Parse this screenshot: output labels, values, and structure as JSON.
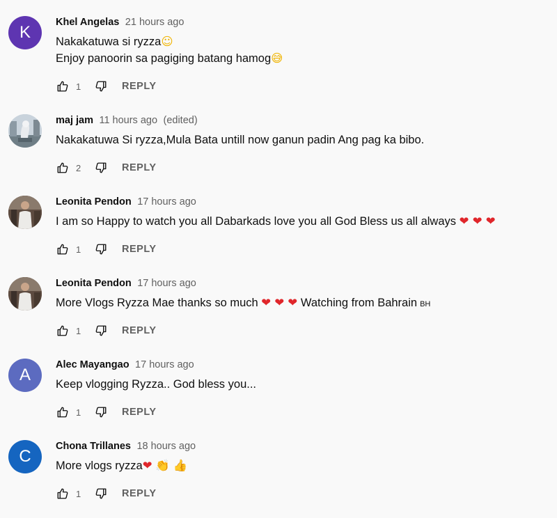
{
  "reply_label": "REPLY",
  "comments": [
    {
      "author": "Khel Angelas",
      "time": "21 hours ago",
      "avatar": {
        "letter": "K",
        "color": "#5e35b1"
      },
      "line1": "Nakakatuwa si ryzza",
      "line1_emoji": "☺",
      "line2": "Enjoy panoorin sa pagiging batang hamog",
      "line2_emoji": "😅",
      "likes": "1"
    },
    {
      "author": "maj jam",
      "time": "11 hours ago",
      "edited": "(edited)",
      "avatar": {
        "image": "merlion-statue-photo"
      },
      "line1": "Nakakatuwa Si ryzza,Mula Bata untill now ganun padin Ang pag ka bibo.",
      "likes": "2"
    },
    {
      "author": "Leonita Pendon",
      "time": "17 hours ago",
      "avatar": {
        "image": "person-photo"
      },
      "line1": "I am so Happy to watch you all Dabarkads love you all God Bless us all always",
      "hearts": "❤ ❤ ❤",
      "likes": "1"
    },
    {
      "author": "Leonita Pendon",
      "time": "17 hours ago",
      "avatar": {
        "image": "person-photo"
      },
      "line1": "More Vlogs Ryzza Mae thanks so much",
      "hearts": "❤ ❤ ❤",
      "line1_tail": "Watching from Bahrain",
      "flag": "BH",
      "likes": "1"
    },
    {
      "author": "Alec Mayangao",
      "time": "17 hours ago",
      "avatar": {
        "letter": "A",
        "color": "#5c6bc0"
      },
      "line1": "Keep vlogging Ryzza.. God bless you...",
      "likes": "1"
    },
    {
      "author": "Chona Trillanes",
      "time": "18 hours ago",
      "avatar": {
        "letter": "C",
        "color": "#1565c0"
      },
      "line1": "More vlogs ryzza",
      "hearts": "❤",
      "trail_emoji": "👏 👍",
      "likes": "1"
    }
  ]
}
